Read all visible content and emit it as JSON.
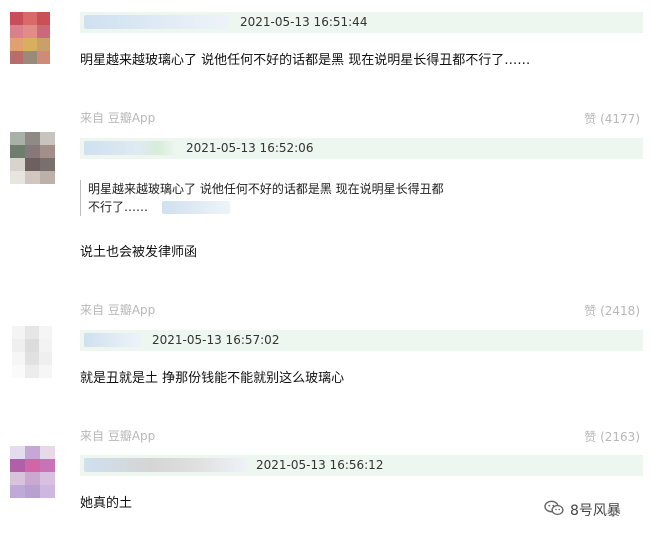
{
  "comments": [
    {
      "timestamp": "2021-05-13 16:51:44",
      "text": "明星越来越玻璃心了 说他任何不好的话都是黑 现在说明星长得丑都不行了……",
      "source": "来自 豆瓣App",
      "vote": "赞 (4177)"
    },
    {
      "timestamp": "2021-05-13 16:52:06",
      "quote_line1": "明星越来越玻璃心了 说他任何不好的话都是黑 现在说明星长得丑都",
      "quote_line2": "不行了……",
      "text": "说土也会被发律师函",
      "source": "来自 豆瓣App",
      "vote": "赞 (2418)"
    },
    {
      "timestamp": "2021-05-13 16:57:02",
      "text": "就是丑就是土 挣那份钱能不能就别这么玻璃心",
      "source": "来自 豆瓣App",
      "vote": "赞 (2163)"
    },
    {
      "timestamp": "2021-05-13 16:56:12",
      "text": "她真的土"
    }
  ],
  "watermark": {
    "icon": "wechat-icon",
    "label": "8号风暴"
  },
  "colors": {
    "meta": "#b8b8b8",
    "bar": "#eef6f0"
  }
}
